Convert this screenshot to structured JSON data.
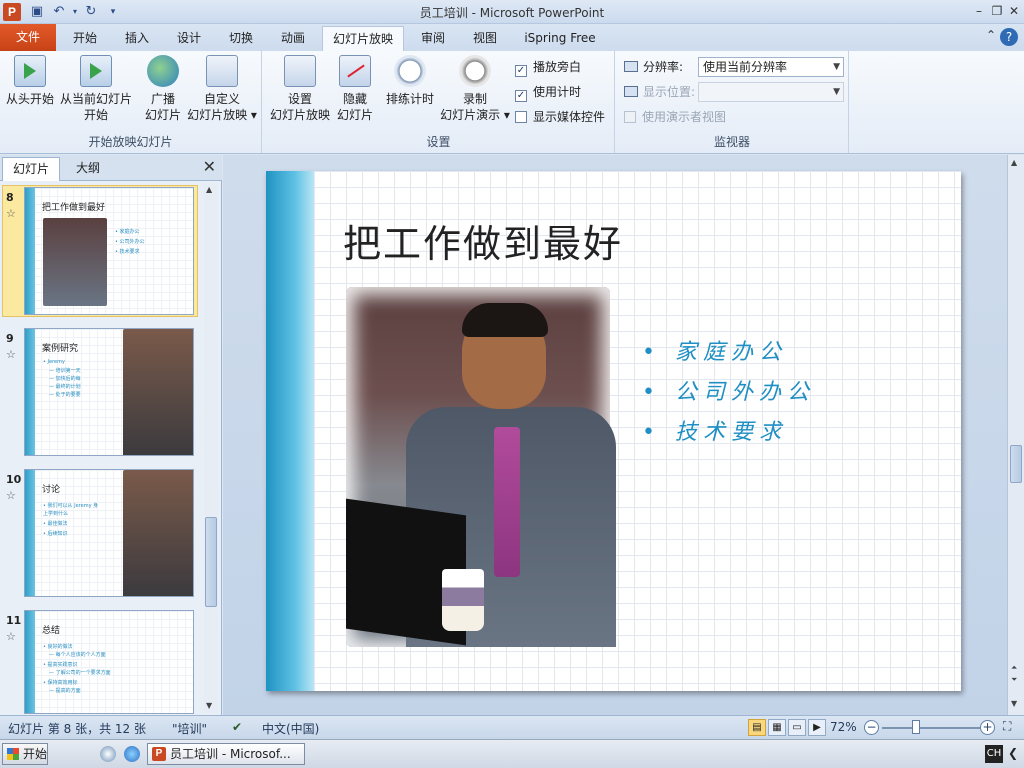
{
  "window": {
    "title": "员工培训 - Microsoft PowerPoint"
  },
  "tabs": [
    "文件",
    "开始",
    "插入",
    "设计",
    "切换",
    "动画",
    "幻灯片放映",
    "审阅",
    "视图",
    "iSpring Free"
  ],
  "ribbon": {
    "group_start": {
      "label": "开始放映幻灯片",
      "from_start": "从头开始",
      "from_current_1": "从当前幻灯片",
      "from_current_2": "开始",
      "broadcast_1": "广播",
      "broadcast_2": "幻灯片",
      "custom_1": "自定义",
      "custom_2": "幻灯片放映 ▾"
    },
    "group_setup": {
      "label": "设置",
      "setup_1": "设置",
      "setup_2": "幻灯片放映",
      "hide_1": "隐藏",
      "hide_2": "幻灯片",
      "rehearse": "排练计时",
      "record_1": "录制",
      "record_2": "幻灯片演示 ▾",
      "chk_narration": "播放旁白",
      "chk_timing": "使用计时",
      "chk_media": "显示媒体控件"
    },
    "group_monitors": {
      "label": "监视器",
      "resolution_label": "分辨率:",
      "resolution_value": "使用当前分辨率",
      "show_on_label": "显示位置:",
      "presenter_view": "使用演示者视图"
    }
  },
  "pane": {
    "tab_slides": "幻灯片",
    "tab_outline": "大纲",
    "thumbs": [
      {
        "num": "8",
        "title": "把工作做到最好",
        "bullets": [
          "• 家庭办公",
          "• 公司外办公",
          "• 技术要求"
        ]
      },
      {
        "num": "9",
        "title": "案例研究",
        "bullets": [
          "• Jeremy",
          "— 培训第一天",
          "— 加快后的每",
          "— 最终的计划",
          "— 处于的要要"
        ]
      },
      {
        "num": "10",
        "title": "讨论",
        "bullets": [
          "• 我们可以从 Jeremy 身",
          "  上学到什么",
          "• 最佳做法",
          "• 后续知识"
        ]
      },
      {
        "num": "11",
        "title": "总结",
        "bullets": [
          "• 良好的做法",
          "— 每个人应该的个人方面",
          "• 提高实践意识",
          "— 了解公司的一个要求方面",
          "• 保持高效用标",
          "— 提高的方面"
        ]
      }
    ]
  },
  "slide": {
    "title": "把工作做到最好",
    "bullets": [
      "家庭办公",
      "公司外办公",
      "技术要求"
    ]
  },
  "status": {
    "slide_info": "幻灯片 第 8 张，共 12 张",
    "theme": "\"培训\"",
    "language": "中文(中国)",
    "zoom": "72%",
    "zoom_fraction": 0.72
  },
  "taskbar": {
    "start": "开始",
    "task": "员工培训 - Microsof...",
    "ime": "CH"
  },
  "colors": {
    "file_tab": "#c74216",
    "accent_blue": "#1f8fc4",
    "selection": "#fbe9a0"
  }
}
